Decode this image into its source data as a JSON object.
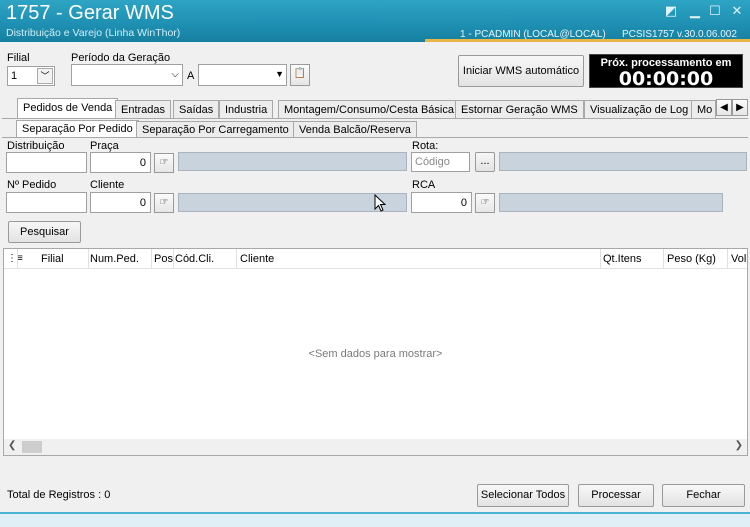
{
  "window": {
    "title": "1757 - Gerar WMS",
    "subtitle": "Distribuição e Varejo (Linha WinThor)",
    "user": "1 - PCADMIN (LOCAL@LOCAL)",
    "version": "PCSIS1757  v.30.0.06.002"
  },
  "header": {
    "filial_label": "Filial",
    "filial_value": "1",
    "periodo_label": "Período da Geração",
    "a_label": "A",
    "iniciar_button": "Iniciar WMS automático",
    "prox_label": "Próx. processamento em",
    "prox_time": "00:00:00"
  },
  "tabs": [
    {
      "label": "Pedidos de Venda"
    },
    {
      "label": "Entradas"
    },
    {
      "label": "Saídas"
    },
    {
      "label": "Industria"
    },
    {
      "label": "Montagem/Consumo/Cesta Básica"
    },
    {
      "label": "Estornar Geração WMS"
    },
    {
      "label": "Visualização de Log"
    },
    {
      "label": "Mo"
    }
  ],
  "subtabs": [
    {
      "label": "Separação Por Pedido"
    },
    {
      "label": "Separação Por Carregamento"
    },
    {
      "label": "Venda Balcão/Reserva"
    }
  ],
  "form": {
    "distribuicao_label": "Distribuição",
    "praca_label": "Praça",
    "praca_value": "0",
    "rota_label": "Rota:",
    "rota_placeholder": "Código",
    "ellipsis": "...",
    "pedido_label": "Nº Pedido",
    "cliente_label": "Cliente",
    "cliente_value": "0",
    "rca_label": "RCA",
    "rca_value": "0",
    "pesquisar": "Pesquisar"
  },
  "grid": {
    "columns": [
      "Filial",
      "Num.Ped.",
      "Pos",
      "Cód.Cli.",
      "Cliente",
      "Qt.Itens",
      "Peso (Kg)",
      "Volu"
    ],
    "empty": "<Sem dados para mostrar>"
  },
  "footer": {
    "total": "Total de Registros : 0",
    "selecionar": "Selecionar Todos",
    "processar": "Processar",
    "fechar": "Fechar"
  },
  "colors": {
    "title_bar": "#1e8fb2",
    "accent": "#49b4d2"
  }
}
